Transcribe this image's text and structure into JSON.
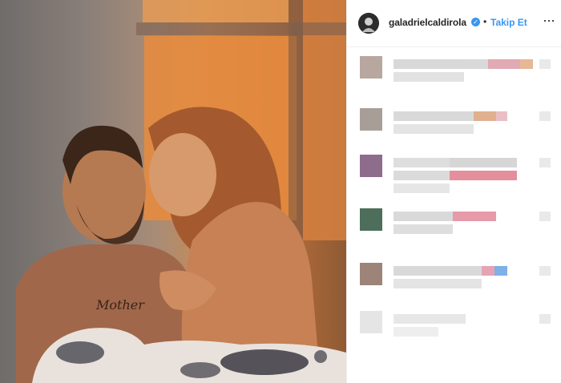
{
  "header": {
    "username": "galadrielcaldirola",
    "verified_mark": "✓",
    "separator": "•",
    "follow_label": "Takip Et",
    "more_label": "···"
  },
  "colors": {
    "link": "#3897f0",
    "text": "#262626",
    "divider": "#efefef"
  },
  "icons": {
    "verified": "verified-badge-icon",
    "more": "more-options-icon",
    "like": "heart-icon"
  },
  "comments": [
    {
      "avatar_color": "#b7a79f",
      "blocks": [
        [
          "#d8d8d8",
          "#d9d9d9",
          "#e0a9b3",
          "#e6b894"
        ],
        [
          "#e2e2e2"
        ]
      ]
    },
    {
      "avatar_color": "#a89e98",
      "blocks": [
        [
          "#d9d9d9",
          "#e0b08f",
          "#e9bfc5"
        ],
        [
          "#e4e4e4"
        ]
      ]
    },
    {
      "avatar_color": "#8e6c8c",
      "blocks": [
        [
          "#dedede",
          "#d6d6d6"
        ],
        [
          "#dbdbdb",
          "#e38f9c"
        ],
        [
          "#e6e6e6"
        ]
      ]
    },
    {
      "avatar_color": "#4d6e5a",
      "blocks": [
        [
          "#d9d9d9",
          "#e79aa8"
        ],
        [
          "#dedede"
        ]
      ]
    },
    {
      "avatar_color": "#9d8478",
      "blocks": [
        [
          "#d9d9d9",
          "#e6a4b3",
          "#7fb0e6"
        ],
        [
          "#e4e4e4"
        ]
      ]
    },
    {
      "avatar_color": "#e5e5e5",
      "blocks": [
        [
          "#e7e7e7"
        ],
        [
          "#eeeeee"
        ]
      ]
    }
  ]
}
